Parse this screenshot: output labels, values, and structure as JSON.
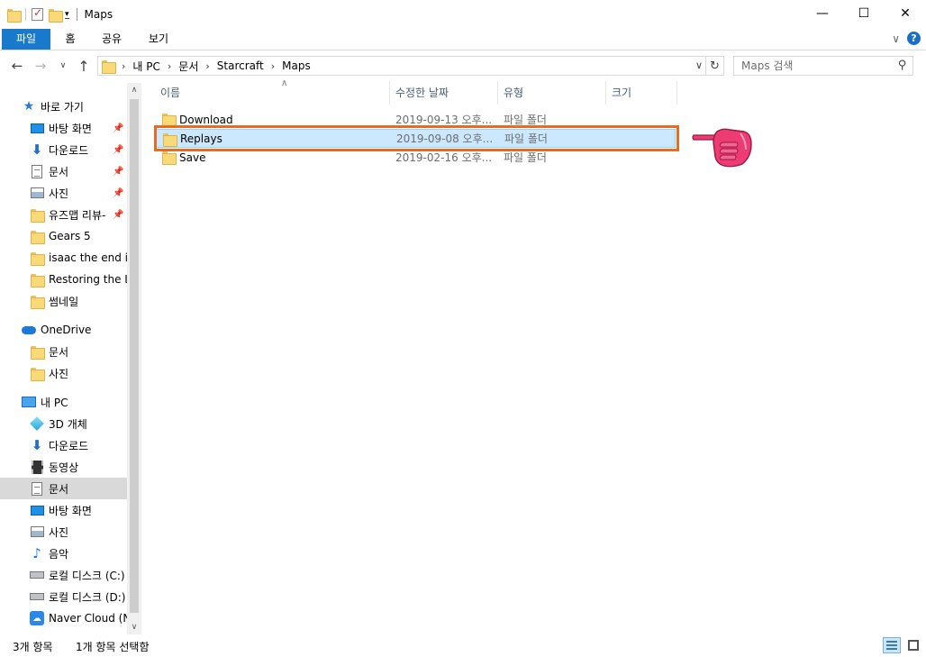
{
  "window": {
    "title": "Maps",
    "minimize": "—",
    "maximize": "☐",
    "close": "✕"
  },
  "ribbon": {
    "tabs": [
      "파일",
      "홈",
      "공유",
      "보기"
    ],
    "help": "?"
  },
  "address": {
    "breadcrumbs": [
      "내 PC",
      "문서",
      "Starcraft",
      "Maps"
    ],
    "search_placeholder": "Maps 검색"
  },
  "sidebar": {
    "items": [
      {
        "label": "바로 가기",
        "icon": "star-icon",
        "pinned": false
      },
      {
        "label": "바탕 화면",
        "icon": "desktop-icon",
        "pinned": true
      },
      {
        "label": "다운로드",
        "icon": "download-icon",
        "pinned": true
      },
      {
        "label": "문서",
        "icon": "document-icon",
        "pinned": true
      },
      {
        "label": "사진",
        "icon": "pictures-icon",
        "pinned": true
      },
      {
        "label": "유즈맵 리뷰-",
        "icon": "folder-icon",
        "pinned": true
      },
      {
        "label": "Gears 5",
        "icon": "folder-icon",
        "pinned": false
      },
      {
        "label": "isaac the end is",
        "icon": "folder-icon",
        "pinned": false
      },
      {
        "label": "Restoring the Li",
        "icon": "folder-icon",
        "pinned": false
      },
      {
        "label": "썸네일",
        "icon": "folder-icon",
        "pinned": false
      },
      {
        "label": "OneDrive",
        "icon": "onedrive-icon",
        "pinned": false
      },
      {
        "label": "문서",
        "icon": "folder-icon",
        "pinned": false
      },
      {
        "label": "사진",
        "icon": "folder-icon",
        "pinned": false
      },
      {
        "label": "내 PC",
        "icon": "pc-icon",
        "pinned": false
      },
      {
        "label": "3D 개체",
        "icon": "3d-objects-icon",
        "pinned": false
      },
      {
        "label": "다운로드",
        "icon": "download-icon",
        "pinned": false
      },
      {
        "label": "동영상",
        "icon": "video-icon",
        "pinned": false
      },
      {
        "label": "문서",
        "icon": "document-icon",
        "pinned": false,
        "selected": true
      },
      {
        "label": "바탕 화면",
        "icon": "desktop-icon",
        "pinned": false
      },
      {
        "label": "사진",
        "icon": "pictures-icon",
        "pinned": false
      },
      {
        "label": "음악",
        "icon": "music-icon",
        "pinned": false
      },
      {
        "label": "로컬 디스크 (C:)",
        "icon": "drive-icon",
        "pinned": false
      },
      {
        "label": "로컬 디스크 (D:)",
        "icon": "drive-icon",
        "pinned": false
      },
      {
        "label": "Naver Cloud (N:)",
        "icon": "naver-cloud-icon",
        "pinned": false
      }
    ]
  },
  "columns": [
    "이름",
    "수정한 날짜",
    "유형",
    "크기"
  ],
  "files": [
    {
      "name": "Download",
      "date": "2019-09-13 오후...",
      "type": "파일 폴더",
      "selected": false
    },
    {
      "name": "Replays",
      "date": "2019-09-08 오후...",
      "type": "파일 폴더",
      "selected": true
    },
    {
      "name": "Save",
      "date": "2019-02-16 오후...",
      "type": "파일 폴더",
      "selected": false
    }
  ],
  "status": {
    "count": "3개 항목",
    "selection": "1개 항목 선택함"
  },
  "colors": {
    "file_tab": "#1979ca",
    "selection": "#cce8ff",
    "highlight": "#ec6a1f",
    "hand": "#e8326e"
  }
}
